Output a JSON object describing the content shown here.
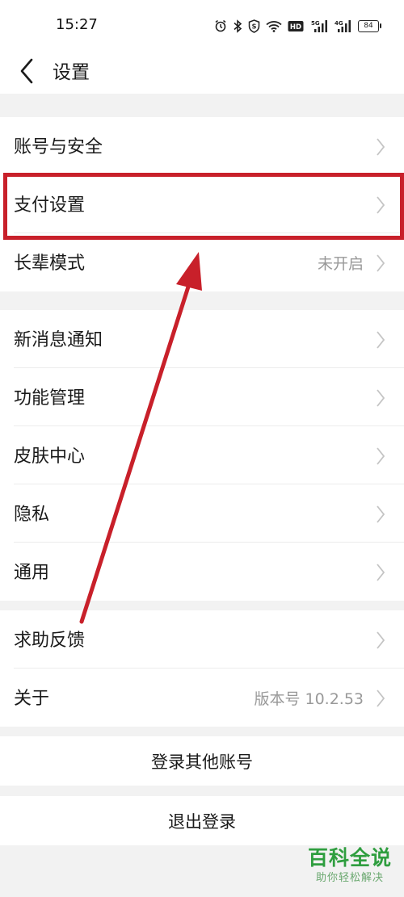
{
  "status_bar": {
    "time": "15:27",
    "battery": "84",
    "icons": [
      "alarm-icon",
      "bluetooth-icon",
      "shield-icon",
      "wifi-icon",
      "hd-icon",
      "signal-5g-icon",
      "signal-4g-icon",
      "battery-icon"
    ],
    "labels": {
      "hd": "HD",
      "net1": "5G",
      "net2": "4G"
    }
  },
  "nav": {
    "title": "设置",
    "back_icon": "chevron-left-icon"
  },
  "groups": [
    {
      "items": [
        {
          "label": "账号与安全",
          "value": ""
        },
        {
          "label": "支付设置",
          "value": ""
        },
        {
          "label": "长辈模式",
          "value": "未开启"
        }
      ]
    },
    {
      "items": [
        {
          "label": "新消息通知",
          "value": ""
        },
        {
          "label": "功能管理",
          "value": ""
        },
        {
          "label": "皮肤中心",
          "value": ""
        },
        {
          "label": "隐私",
          "value": ""
        },
        {
          "label": "通用",
          "value": ""
        }
      ]
    },
    {
      "items": [
        {
          "label": "求助反馈",
          "value": ""
        },
        {
          "label": "关于",
          "value": "版本号 10.2.53"
        }
      ]
    }
  ],
  "actions": {
    "switch_account": "登录其他账号",
    "logout": "退出登录"
  },
  "watermark": {
    "main": "百科全说",
    "sub": "助你轻松解决"
  },
  "colors": {
    "highlight": "#c8202a",
    "background": "#f2f2f2",
    "watermark": "#2f9e3f"
  }
}
